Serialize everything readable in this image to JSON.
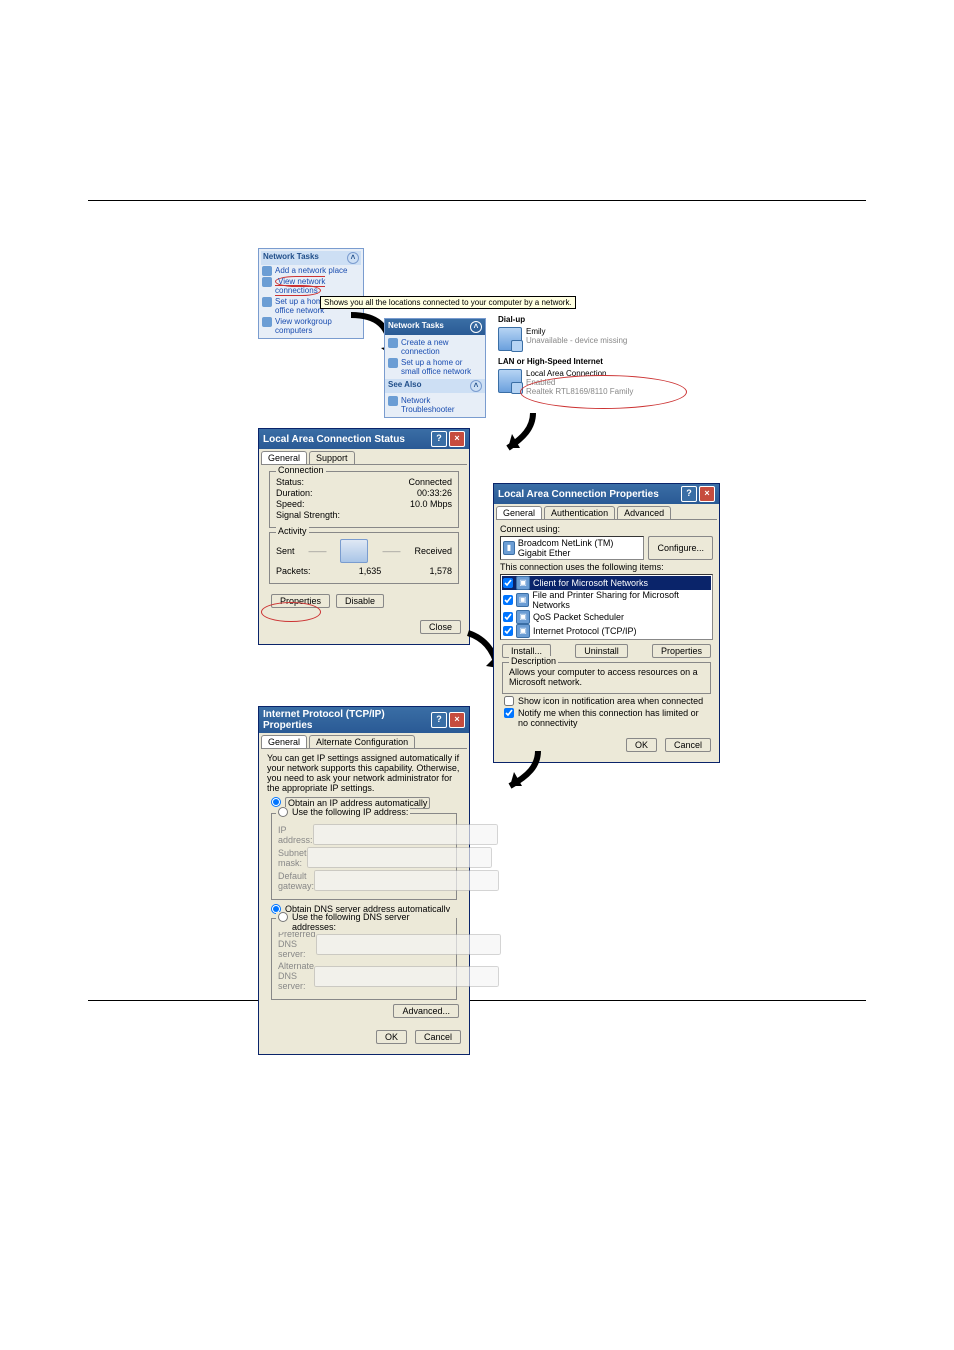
{
  "sidebar_tasks": {
    "header": "Network Tasks",
    "items": [
      "Add a network place",
      "View network connections",
      "Set up a home or small office network",
      "View workgroup computers"
    ],
    "tooltip": "Shows you all the locations connected to your computer by a network."
  },
  "sidebar2": {
    "header": "Network Tasks",
    "items": [
      "Create a new connection",
      "Set up a home or small office network"
    ],
    "see_also_header": "See Also",
    "see_also_items": [
      "Network Troubleshooter"
    ]
  },
  "connections": {
    "dialup_header": "Dial-up",
    "dialup": {
      "name": "Emily",
      "status": "Unavailable - device missing"
    },
    "lan_header": "LAN or High-Speed Internet",
    "lan": {
      "name": "Local Area Connection",
      "status": "Enabled",
      "device": "Realtek RTL8169/8110 Family"
    }
  },
  "status_dialog": {
    "title": "Local Area Connection Status",
    "tabs": [
      "General",
      "Support"
    ],
    "connection_legend": "Connection",
    "status_label": "Status:",
    "status_value": "Connected",
    "duration_label": "Duration:",
    "duration_value": "00:33:26",
    "speed_label": "Speed:",
    "speed_value": "10.0 Mbps",
    "signal_label": "Signal Strength:",
    "activity_legend": "Activity",
    "sent": "Sent",
    "received": "Received",
    "packets_label": "Packets:",
    "packets_sent": "1,635",
    "packets_recv": "1,578",
    "btn_properties": "Properties",
    "btn_disable": "Disable",
    "btn_close": "Close"
  },
  "props_dialog": {
    "title": "Local Area Connection Properties",
    "tabs": [
      "General",
      "Authentication",
      "Advanced"
    ],
    "connect_using": "Connect using:",
    "adapter": "Broadcom NetLink (TM) Gigabit Ether",
    "btn_configure": "Configure...",
    "uses_items_label": "This connection uses the following items:",
    "items": [
      "Client for Microsoft Networks",
      "File and Printer Sharing for Microsoft Networks",
      "QoS Packet Scheduler",
      "Internet Protocol (TCP/IP)"
    ],
    "btn_install": "Install...",
    "btn_uninstall": "Uninstall",
    "btn_props": "Properties",
    "desc_legend": "Description",
    "desc_text": "Allows your computer to access resources on a Microsoft network.",
    "chk_show": "Show icon in notification area when connected",
    "chk_notify": "Notify me when this connection has limited or no connectivity",
    "btn_ok": "OK",
    "btn_cancel": "Cancel"
  },
  "tcpip_dialog": {
    "title": "Internet Protocol (TCP/IP) Properties",
    "tabs": [
      "General",
      "Alternate Configuration"
    ],
    "intro": "You can get IP settings assigned automatically if your network supports this capability. Otherwise, you need to ask your network administrator for the appropriate IP settings.",
    "opt_auto_ip": "Obtain an IP address automatically",
    "opt_use_ip": "Use the following IP address:",
    "lbl_ip": "IP address:",
    "lbl_mask": "Subnet mask:",
    "lbl_gw": "Default gateway:",
    "opt_auto_dns": "Obtain DNS server address automatically",
    "opt_use_dns": "Use the following DNS server addresses:",
    "lbl_dns1": "Preferred DNS server:",
    "lbl_dns2": "Alternate DNS server:",
    "btn_adv": "Advanced...",
    "btn_ok": "OK",
    "btn_cancel": "Cancel"
  }
}
